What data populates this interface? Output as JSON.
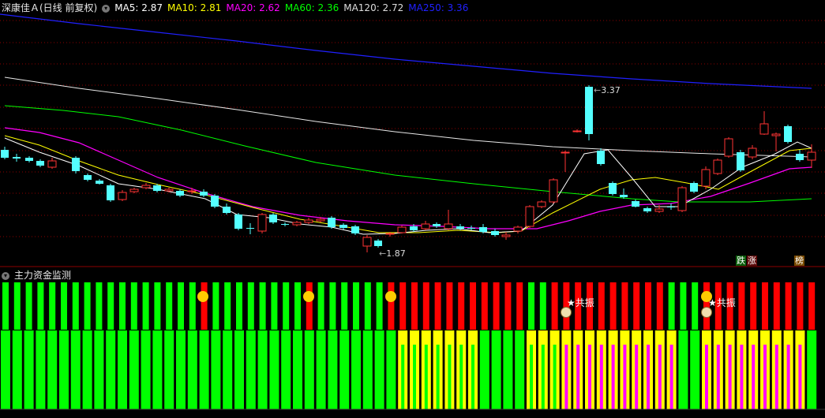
{
  "header": {
    "title": "深康佳Ａ(日线 前复权)",
    "indicators": [
      {
        "label": "MA5: 2.87",
        "color": "#ffffff"
      },
      {
        "label": "MA10: 2.81",
        "color": "#ffff00"
      },
      {
        "label": "MA20: 2.62",
        "color": "#ff00ff"
      },
      {
        "label": "MA60: 2.36",
        "color": "#00ff00"
      },
      {
        "label": "MA120: 2.72",
        "color": "#dddddd"
      },
      {
        "label": "MA250: 3.36",
        "color": "#2020ff"
      }
    ]
  },
  "chart_annotations": {
    "high_label": "3.37",
    "low_label": "1.87",
    "tag_die": "跌",
    "tag_zhang": "涨",
    "tag_bang": "榜"
  },
  "sub_panel": {
    "title": "主力资金监测",
    "resonance_label_1": "共振",
    "resonance_label_2": "共振"
  },
  "colors": {
    "up": "#ff3333",
    "down": "#54ffff",
    "green_bar": "#00ff00",
    "red_bar": "#ff0000",
    "yellow_bar": "#ffff00",
    "magenta_bar": "#ff00ff",
    "grid": "#8b0000"
  }
}
